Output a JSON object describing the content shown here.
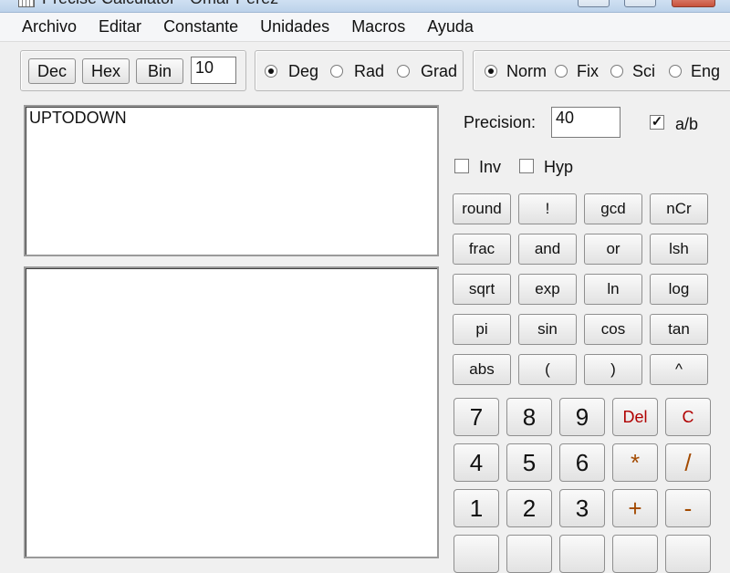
{
  "window": {
    "title": "Precise Calculator - Omar Perez"
  },
  "menu": [
    "Archivo",
    "Editar",
    "Constante",
    "Unidades",
    "Macros",
    "Ayuda"
  ],
  "base": {
    "buttons": [
      "Dec",
      "Hex",
      "Bin"
    ],
    "value": "10"
  },
  "angle": {
    "options": [
      "Deg",
      "Rad",
      "Grad"
    ],
    "selected": "Deg"
  },
  "format": {
    "options": [
      "Norm",
      "Fix",
      "Sci",
      "Eng"
    ],
    "selected": "Norm"
  },
  "expression": "UPTODOWN",
  "precision": {
    "label": "Precision:",
    "value": "40"
  },
  "fraction": {
    "label": "a/b",
    "checked": true
  },
  "inv": {
    "label": "Inv",
    "checked": false
  },
  "hyp": {
    "label": "Hyp",
    "checked": false
  },
  "functions": [
    [
      "round",
      "!",
      "gcd",
      "nCr"
    ],
    [
      "frac",
      "and",
      "or",
      "lsh"
    ],
    [
      "sqrt",
      "exp",
      "ln",
      "log"
    ],
    [
      "pi",
      "sin",
      "cos",
      "tan"
    ],
    [
      "abs",
      "(",
      ")",
      "^"
    ]
  ],
  "keypad": [
    [
      "7",
      "8",
      "9",
      "Del",
      "C"
    ],
    [
      "4",
      "5",
      "6",
      "*",
      "/"
    ],
    [
      "1",
      "2",
      "3",
      "+",
      "-"
    ]
  ]
}
